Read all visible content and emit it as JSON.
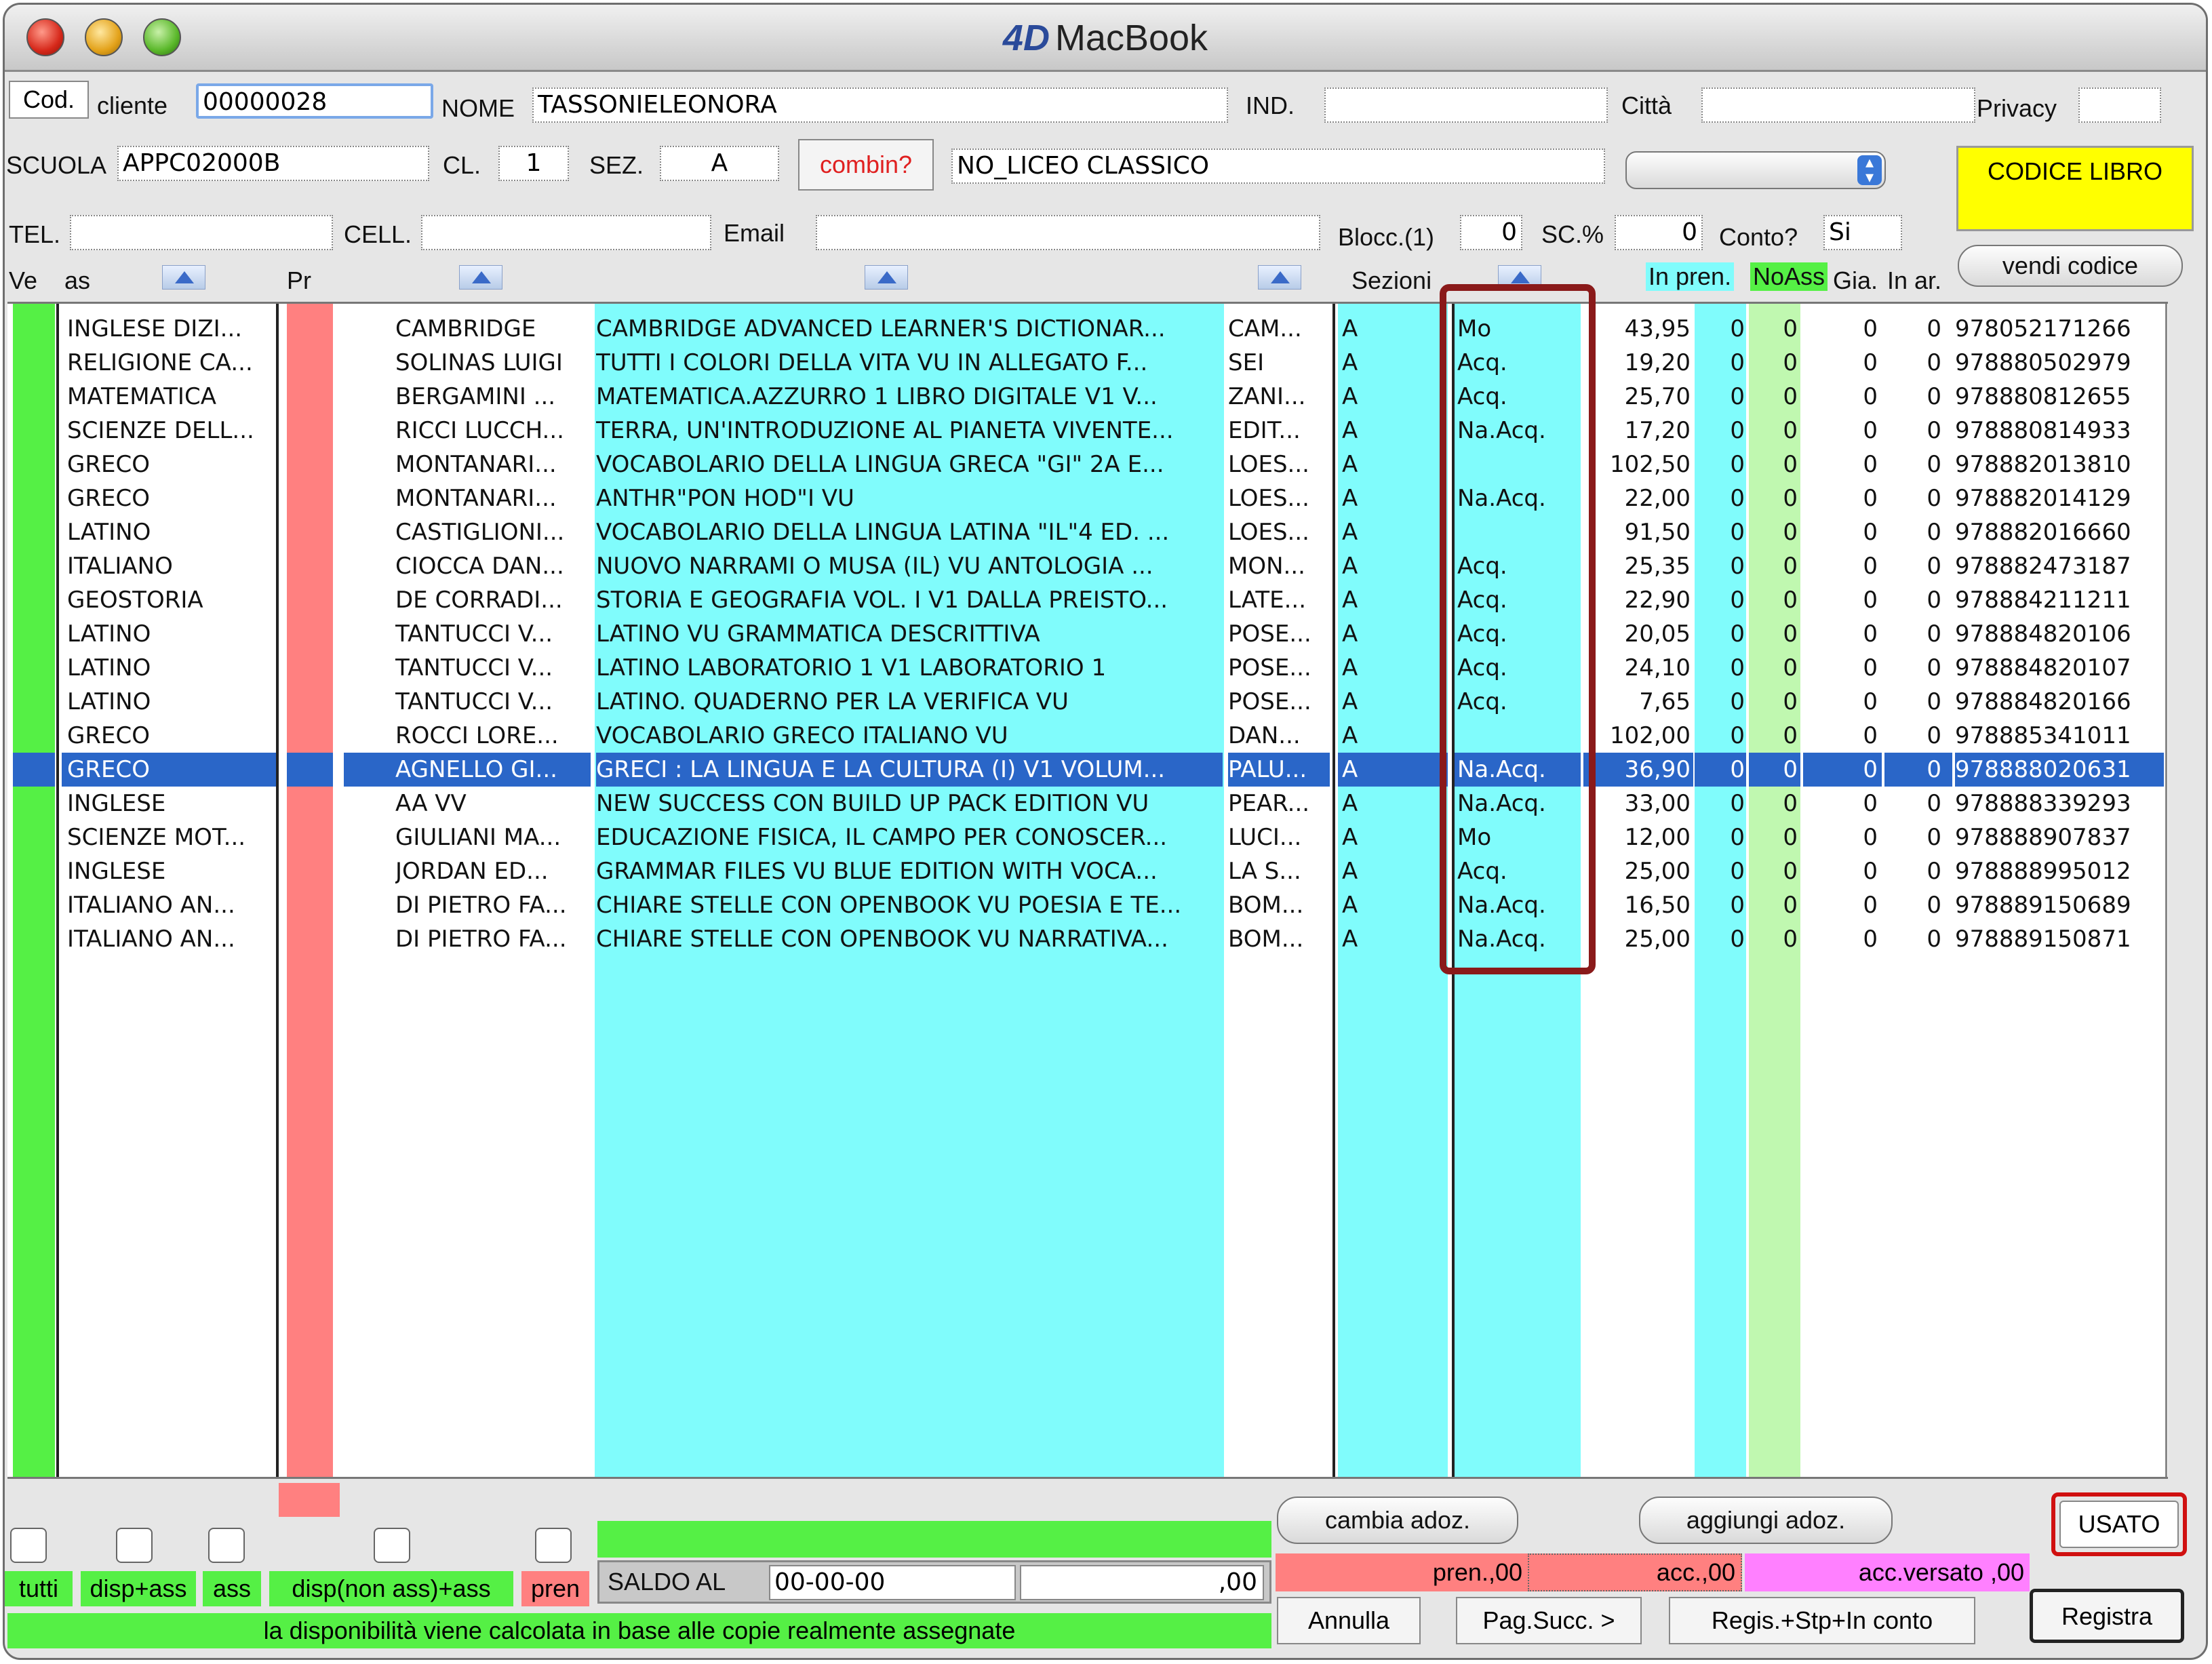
{
  "window": {
    "logo": "4D",
    "title": "MacBook"
  },
  "header": {
    "cod_button": "Cod.",
    "cliente_label": "cliente",
    "cliente_value": "00000028",
    "nome_label": "NOME",
    "nome_value": "TASSONIELEONORA",
    "ind_label": "IND.",
    "ind_value": "",
    "citta_label": "Città",
    "citta_value": "",
    "privacy_label": "Privacy",
    "privacy_value": "",
    "scuola_label": "SCUOLA",
    "scuola_value": "APPC02000B",
    "cl_label": "CL.",
    "cl_value": "1",
    "sez_label": "SEZ.",
    "sez_value": "A",
    "combin_button": "combin?",
    "school_desc": "NO_LICEO CLASSICO",
    "codice_libro_label": "CODICE LIBRO",
    "tel_label": "TEL.",
    "tel_value": "",
    "cell_label": "CELL.",
    "cell_value": "",
    "email_label": "Email",
    "email_value": "",
    "blocc_label": "Blocc.(1)",
    "blocc_value": "0",
    "sc_label": "SC.%",
    "sc_value": "0",
    "conto_label": "Conto?",
    "conto_value": "Si",
    "vendi_codice_button": "vendi codice"
  },
  "columns": {
    "ve": "Ve",
    "as": "as",
    "pr": "Pr",
    "sezioni": "Sezioni",
    "in_pren": "In pren.",
    "noass": "NoAss",
    "gia": "Gia.",
    "in_ar": "In ar."
  },
  "rows": [
    {
      "materia": "INGLESE DIZI...",
      "autore": "CAMBRIDGE",
      "titolo": "CAMBRIDGE ADVANCED LEARNER'S DICTIONAR...",
      "editore": "CAM...",
      "sez": "A",
      "stato": "Mo",
      "prezzo": "43,95",
      "inpren": "0",
      "noass": "0",
      "gia": "0",
      "inar": "0",
      "isbn": "978052171266"
    },
    {
      "materia": "RELIGIONE CA...",
      "autore": "SOLINAS LUIGI",
      "titolo": "TUTTI I COLORI DELLA VITA VU IN ALLEGATO F...",
      "editore": "SEI",
      "sez": "A",
      "stato": "Acq.",
      "prezzo": "19,20",
      "inpren": "0",
      "noass": "0",
      "gia": "0",
      "inar": "0",
      "isbn": "978880502979"
    },
    {
      "materia": "MATEMATICA",
      "autore": "BERGAMINI ...",
      "titolo": "MATEMATICA.AZZURRO 1 LIBRO DIGITALE V1 V...",
      "editore": "ZANI...",
      "sez": "A",
      "stato": "Acq.",
      "prezzo": "25,70",
      "inpren": "0",
      "noass": "0",
      "gia": "0",
      "inar": "0",
      "isbn": "978880812655"
    },
    {
      "materia": "SCIENZE DELL...",
      "autore": "RICCI LUCCH...",
      "titolo": "TERRA, UN'INTRODUZIONE AL PIANETA VIVENTE...",
      "editore": "EDIT...",
      "sez": "A",
      "stato": "Na.Acq.",
      "prezzo": "17,20",
      "inpren": "0",
      "noass": "0",
      "gia": "0",
      "inar": "0",
      "isbn": "978880814933"
    },
    {
      "materia": "GRECO",
      "autore": "MONTANARI...",
      "titolo": "VOCABOLARIO DELLA LINGUA GRECA \"GI\" 2A E...",
      "editore": "LOES...",
      "sez": "A",
      "stato": "",
      "prezzo": "102,50",
      "inpren": "0",
      "noass": "0",
      "gia": "0",
      "inar": "0",
      "isbn": "978882013810"
    },
    {
      "materia": "GRECO",
      "autore": "MONTANARI...",
      "titolo": "ANTHR\"PON HOD\"I VU",
      "editore": "LOES...",
      "sez": "A",
      "stato": "Na.Acq.",
      "prezzo": "22,00",
      "inpren": "0",
      "noass": "0",
      "gia": "0",
      "inar": "0",
      "isbn": "978882014129"
    },
    {
      "materia": "LATINO",
      "autore": "CASTIGLIONI...",
      "titolo": "VOCABOLARIO DELLA LINGUA LATINA \"IL\"4 ED. ...",
      "editore": "LOES...",
      "sez": "A",
      "stato": "",
      "prezzo": "91,50",
      "inpren": "0",
      "noass": "0",
      "gia": "0",
      "inar": "0",
      "isbn": "978882016660"
    },
    {
      "materia": "ITALIANO",
      "autore": "CIOCCA DAN...",
      "titolo": "NUOVO NARRAMI O MUSA (IL) VU ANTOLOGIA ...",
      "editore": "MON...",
      "sez": "A",
      "stato": "Acq.",
      "prezzo": "25,35",
      "inpren": "0",
      "noass": "0",
      "gia": "0",
      "inar": "0",
      "isbn": "978882473187"
    },
    {
      "materia": "GEOSTORIA",
      "autore": "DE CORRADI...",
      "titolo": "STORIA E GEOGRAFIA VOL. I V1 DALLA PREISTO...",
      "editore": "LATE...",
      "sez": "A",
      "stato": "Acq.",
      "prezzo": "22,90",
      "inpren": "0",
      "noass": "0",
      "gia": "0",
      "inar": "0",
      "isbn": "978884211211"
    },
    {
      "materia": "LATINO",
      "autore": "TANTUCCI V...",
      "titolo": "LATINO VU GRAMMATICA DESCRITTIVA",
      "editore": "POSE...",
      "sez": "A",
      "stato": "Acq.",
      "prezzo": "20,05",
      "inpren": "0",
      "noass": "0",
      "gia": "0",
      "inar": "0",
      "isbn": "978884820106"
    },
    {
      "materia": "LATINO",
      "autore": "TANTUCCI V...",
      "titolo": "LATINO LABORATORIO 1 V1 LABORATORIO 1",
      "editore": "POSE...",
      "sez": "A",
      "stato": "Acq.",
      "prezzo": "24,10",
      "inpren": "0",
      "noass": "0",
      "gia": "0",
      "inar": "0",
      "isbn": "978884820107"
    },
    {
      "materia": "LATINO",
      "autore": "TANTUCCI V...",
      "titolo": "LATINO. QUADERNO PER LA VERIFICA VU",
      "editore": "POSE...",
      "sez": "A",
      "stato": "Acq.",
      "prezzo": "7,65",
      "inpren": "0",
      "noass": "0",
      "gia": "0",
      "inar": "0",
      "isbn": "978884820166"
    },
    {
      "materia": "GRECO",
      "autore": "ROCCI LORE...",
      "titolo": "VOCABOLARIO GRECO ITALIANO VU",
      "editore": "DAN...",
      "sez": "A",
      "stato": "",
      "prezzo": "102,00",
      "inpren": "0",
      "noass": "0",
      "gia": "0",
      "inar": "0",
      "isbn": "978885341011"
    },
    {
      "materia": "GRECO",
      "autore": "AGNELLO GI...",
      "titolo": "GRECI : LA LINGUA E LA CULTURA (I) V1 VOLUM...",
      "editore": "PALU...",
      "sez": "A",
      "stato": "Na.Acq.",
      "prezzo": "36,90",
      "inpren": "0",
      "noass": "0",
      "gia": "0",
      "inar": "0",
      "isbn": "978888020631"
    },
    {
      "materia": "INGLESE",
      "autore": "AA VV",
      "titolo": "NEW SUCCESS CON BUILD UP PACK EDITION VU",
      "editore": "PEAR...",
      "sez": "A",
      "stato": "Na.Acq.",
      "prezzo": "33,00",
      "inpren": "0",
      "noass": "0",
      "gia": "0",
      "inar": "0",
      "isbn": "978888339293"
    },
    {
      "materia": "SCIENZE MOT...",
      "autore": "GIULIANI MA...",
      "titolo": "EDUCAZIONE FISICA, IL CAMPO PER CONOSCER...",
      "editore": "LUCI...",
      "sez": "A",
      "stato": "Mo",
      "prezzo": "12,00",
      "inpren": "0",
      "noass": "0",
      "gia": "0",
      "inar": "0",
      "isbn": "978888907837"
    },
    {
      "materia": "INGLESE",
      "autore": "JORDAN ED...",
      "titolo": "GRAMMAR FILES VU BLUE EDITION  WITH VOCA...",
      "editore": "LA S...",
      "sez": "A",
      "stato": "Acq.",
      "prezzo": "25,00",
      "inpren": "0",
      "noass": "0",
      "gia": "0",
      "inar": "0",
      "isbn": "978888995012"
    },
    {
      "materia": "ITALIANO AN...",
      "autore": "DI PIETRO FA...",
      "titolo": "CHIARE STELLE CON OPENBOOK VU POESIA E TE...",
      "editore": "BOM...",
      "sez": "A",
      "stato": "Na.Acq.",
      "prezzo": "16,50",
      "inpren": "0",
      "noass": "0",
      "gia": "0",
      "inar": "0",
      "isbn": "978889150689"
    },
    {
      "materia": "ITALIANO AN...",
      "autore": "DI PIETRO FA...",
      "titolo": "CHIARE STELLE CON OPENBOOK VU NARRATIVA...",
      "editore": "BOM...",
      "sez": "A",
      "stato": "Na.Acq.",
      "prezzo": "25,00",
      "inpren": "0",
      "noass": "0",
      "gia": "0",
      "inar": "0",
      "isbn": "978889150871"
    }
  ],
  "footer": {
    "cambia_adoz": "cambia adoz.",
    "aggiungi_adoz": "aggiungi adoz.",
    "usato": "USATO",
    "tutti": "tutti",
    "disp_ass": "disp+ass",
    "ass": "ass",
    "disp_non_ass": "disp(non ass)+ass",
    "pren": "pren",
    "saldo_label": "SALDO AL",
    "saldo_date": "00-00-00",
    "saldo_amount": ",00",
    "pren_total": "pren.,00",
    "acc_total": "acc.,00",
    "acc_versato": "acc.versato ,00",
    "annulla": "Annulla",
    "pag_succ": "Pag.Succ. >",
    "regis_stp": "Regis.+Stp+In conto",
    "registra": "Registra",
    "info_text": "la disponibilità viene calcolata in base alle copie realmente assegnate"
  },
  "colors": {
    "cyan": "#80fcfc",
    "green": "#55f045",
    "salmon": "#ff8080",
    "selection": "#2a66c8",
    "magenta": "#ff80ff",
    "yellow": "#ffff00",
    "highlight": "#8a1a1a"
  }
}
